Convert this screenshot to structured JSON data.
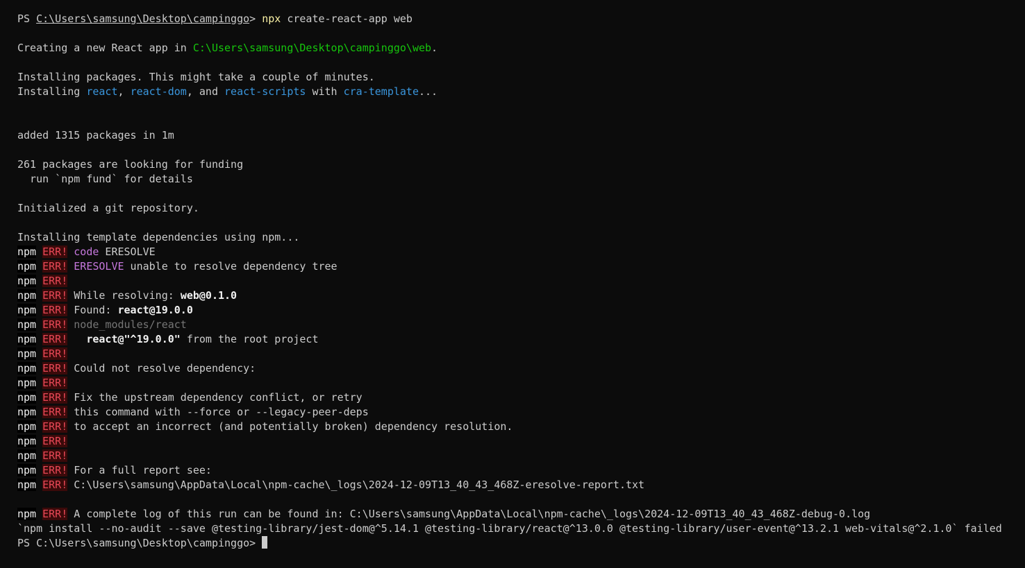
{
  "terminal": {
    "prompt_prefix": "PS ",
    "prompt_path": "C:\\Users\\samsung\\Desktop\\campinggo",
    "prompt_suffix": "> ",
    "cmd_npx": "npx",
    "cmd_rest": " create-react-app web",
    "creating_prefix": "Creating a new React app in ",
    "creating_path": "C:\\Users\\samsung\\Desktop\\campinggo\\web",
    "creating_suffix": ".",
    "installing_packages": "Installing packages. This might take a couple of minutes.",
    "installing_prefix": "Installing ",
    "pkg_react": "react",
    "sep1": ", ",
    "pkg_react_dom": "react-dom",
    "sep2": ", and ",
    "pkg_react_scripts": "react-scripts",
    "with": " with ",
    "pkg_cra_template": "cra-template",
    "ellipsis": "...",
    "added": "added 1315 packages in 1m",
    "funding": "261 packages are looking for funding",
    "run_fund": "  run `npm fund` for details",
    "initialized_git": "Initialized a git repository.",
    "installing_template": "Installing template dependencies using npm...",
    "npm": "npm",
    "err": "ERR!",
    "code_label": "code",
    "code_value": " ERESOLVE",
    "eresolve_label": "ERESOLVE",
    "eresolve_msg": " unable to resolve dependency tree",
    "while_resolving": "While resolving: ",
    "while_resolving_pkg": "web@0.1.0",
    "found": "Found: ",
    "found_pkg": "react@19.0.0",
    "node_modules_react": "node_modules/react",
    "react_range_pkg": "  react@\"^19.0.0\"",
    "react_range_msg": " from the root project",
    "could_not_resolve": "Could not resolve dependency:",
    "fix_upstream": "Fix the upstream dependency conflict, or retry",
    "this_command": "this command with --force or --legacy-peer-deps",
    "to_accept": "to accept an incorrect (and potentially broken) dependency resolution.",
    "full_report": "For a full report see:",
    "report_path": "C:\\Users\\samsung\\AppData\\Local\\npm-cache\\_logs\\2024-12-09T13_40_43_468Z-eresolve-report.txt",
    "complete_log": "A complete log of this run can be found in: C:\\Users\\samsung\\AppData\\Local\\npm-cache\\_logs\\2024-12-09T13_40_43_468Z-debug-0.log",
    "failed_cmd": "`npm install --no-audit --save @testing-library/jest-dom@^5.14.1 @testing-library/react@^13.0.0 @testing-library/user-event@^13.2.1 web-vitals@^2.1.0` failed",
    "final_prompt": "PS C:\\Users\\samsung\\Desktop\\campinggo> "
  }
}
